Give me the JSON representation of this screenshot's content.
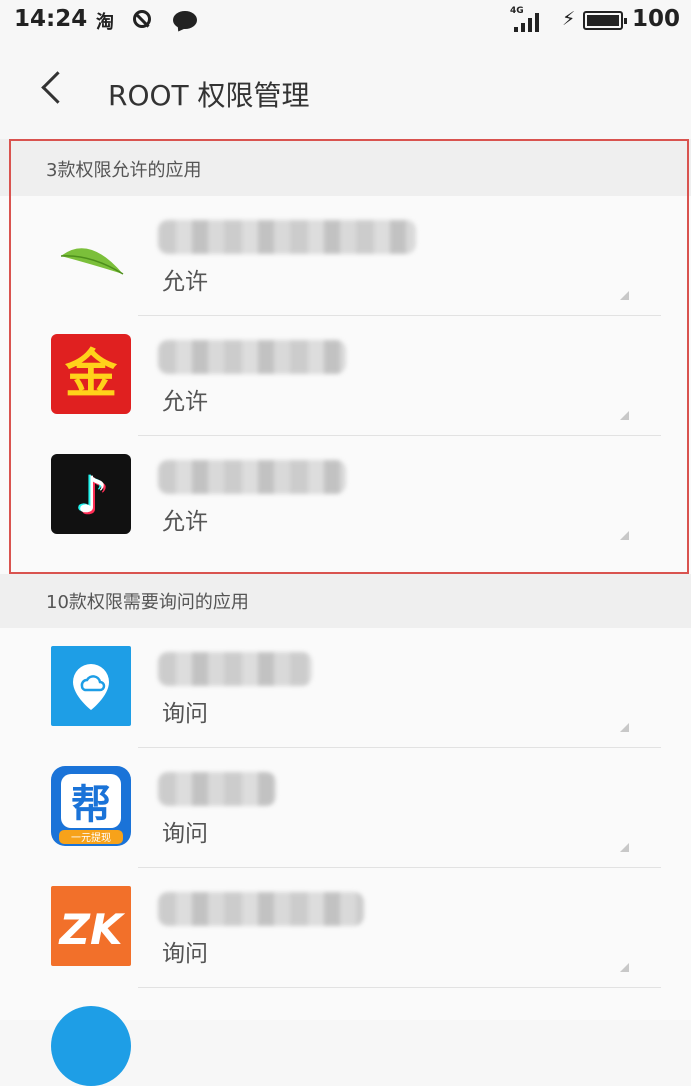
{
  "status_bar": {
    "time": "14:24",
    "taobao_glyph": "淘",
    "network": "4G",
    "battery_level": "100",
    "icons": [
      "taobao-icon",
      "do-not-disturb-icon",
      "message-icon",
      "signal-icon",
      "charging-icon",
      "battery-icon"
    ]
  },
  "header": {
    "title": "ROOT 权限管理",
    "back_icon": "chevron-left-icon"
  },
  "groups": [
    {
      "label": "3款权限允许的应用",
      "apps": [
        {
          "icon": "leaf-icon",
          "permission": "允许"
        },
        {
          "icon": "gold-coin-icon",
          "glyph": "金",
          "permission": "允许"
        },
        {
          "icon": "tiktok-icon",
          "glyph": "♪",
          "permission": "允许"
        }
      ]
    },
    {
      "label": "10款权限需要询问的应用",
      "apps": [
        {
          "icon": "cloud-location-icon",
          "permission": "询问"
        },
        {
          "icon": "bang-icon",
          "glyph": "帮",
          "sublabel": "一元提现",
          "permission": "询问"
        },
        {
          "icon": "zk-icon",
          "glyph": "ZK",
          "permission": "询问"
        }
      ]
    }
  ],
  "colors": {
    "highlight_border": "#d9534f",
    "background": "#f7f7f7"
  }
}
